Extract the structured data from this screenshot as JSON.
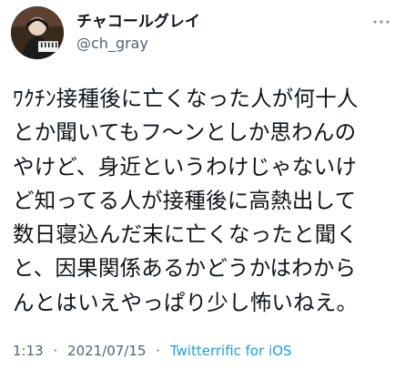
{
  "author": {
    "display_name": "チャコールグレイ",
    "handle": "@ch_gray"
  },
  "icons": {
    "avatar": "avatar-image",
    "more": "more-options-icon"
  },
  "tweet": {
    "text": "ﾜｸﾁﾝ接種後に亡くなった人が何十人\nとか聞いてもフ〜ンとしか思わんの\nやけど、身近というわけじゃないけ\nど知ってる人が接種後に高熱出して\n数日寝込んだ末に亡くなったと聞く\nと、因果関係あるかどうかはわから\nんとはいえやっぱり少し怖いねえ。"
  },
  "meta": {
    "time": "1:13",
    "separator": "·",
    "date": "2021/07/15",
    "client": "Twitterrific for iOS"
  },
  "colors": {
    "text": "#0f1419",
    "secondary": "#536471",
    "link": "#1d9bf0"
  }
}
